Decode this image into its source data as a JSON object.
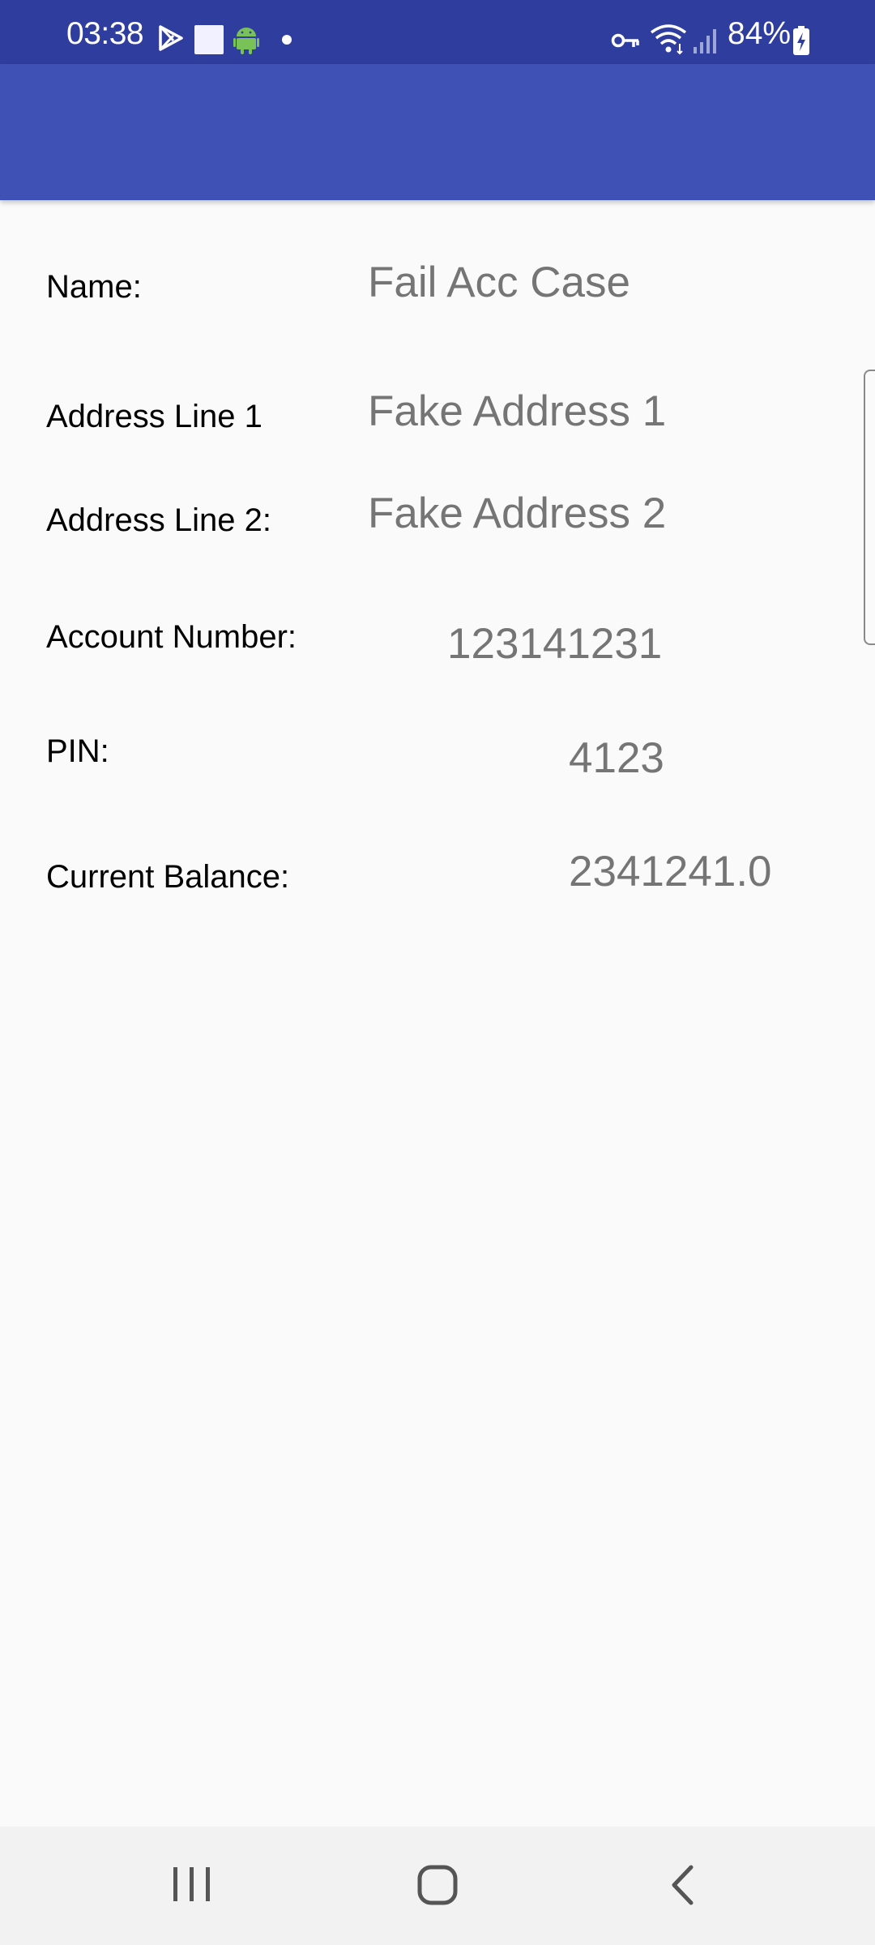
{
  "status_bar": {
    "time": "03:38",
    "battery_percent": "84%",
    "icons": [
      "play-store-icon",
      "square-notification-icon",
      "android-icon",
      "dot-icon",
      "vpn-key-icon",
      "wifi-icon",
      "signal-icon",
      "battery-charging-icon"
    ]
  },
  "app_bar": {
    "color": "#3f51b5",
    "status_color": "#2f3e9e"
  },
  "form": {
    "name_label": "Name:",
    "name_value": "Fail Acc Case",
    "address1_label": "Address Line 1",
    "address1_value": "Fake Address 1",
    "address2_label": "Address Line 2:",
    "address2_value": "Fake Address 2",
    "account_label": "Account Number:",
    "account_value": "123141231",
    "pin_label": "PIN:",
    "pin_value": "4123",
    "balance_label": "Current Balance:",
    "balance_value": "2341241.0"
  },
  "nav_bar": {
    "buttons": [
      "recent-apps-icon",
      "home-icon",
      "back-icon"
    ]
  }
}
